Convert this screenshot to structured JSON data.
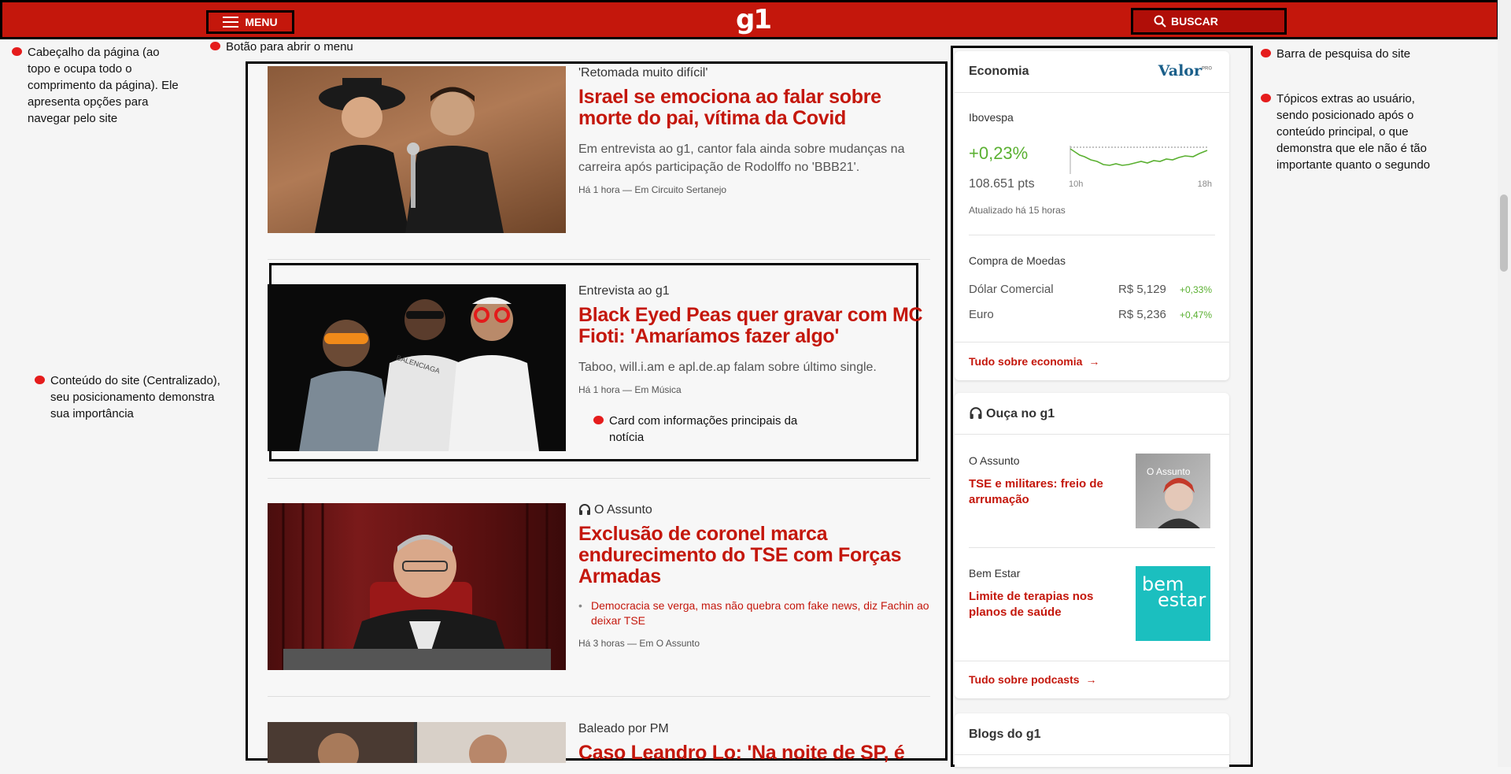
{
  "header": {
    "menu_label": "MENU",
    "logo": "g1",
    "search_label": "BUSCAR"
  },
  "annotations": {
    "header": "Cabeçalho da página (ao topo e ocupa todo o comprimento da página). Ele apresenta opções para navegar pelo site",
    "menu": "Botão para abrir o menu",
    "search": "Barra de pesquisa do site",
    "sidebar": "Tópicos extras ao usuário, sendo posicionado após o conteúdo principal, o que demonstra que ele não é tão importante quanto o segundo",
    "content": "Conteúdo do site (Centralizado), seu posicionamento demonstra sua importância",
    "card": "Card com informações principais da notícia"
  },
  "feed": [
    {
      "chapeu": "'Retomada muito difícil'",
      "headline": "Israel se emociona ao falar sobre morte do pai, vítima da Covid",
      "summary": "Em entrevista ao g1, cantor fala ainda sobre mudanças na carreira após participação de Rodolffo no 'BBB21'.",
      "meta": "Há 1 hora — Em Circuito Sertanejo"
    },
    {
      "chapeu": "Entrevista ao g1",
      "headline": "Black Eyed Peas quer gravar com MC Fioti: 'Amaríamos fazer algo'",
      "summary": "Taboo, will.i.am e apl.de.ap falam sobre último single.",
      "meta": "Há 1 hora — Em Música",
      "image_text": "BALENCIAGA"
    },
    {
      "chapeu": "O Assunto",
      "headline": "Exclusão de coronel marca endurecimento do TSE com Forças Armadas",
      "related": "Democracia se verga, mas não quebra com fake news, diz Fachin ao deixar TSE",
      "meta": "Há 3 horas — Em O Assunto"
    },
    {
      "chapeu": "Baleado por PM",
      "headline": "Caso Leandro Lo: 'Na noite de SP, é"
    }
  ],
  "sidebar": {
    "economia": {
      "title": "Economia",
      "brand": "Valor",
      "brand_sup": "PRO",
      "ibovespa_label": "Ibovespa",
      "ibovespa_change": "+0,23%",
      "ibovespa_points": "108.651 pts",
      "chart_start": "10h",
      "chart_end": "18h",
      "updated": "Atualizado há 15 horas",
      "moedas_label": "Compra de Moedas",
      "moedas": [
        {
          "name": "Dólar Comercial",
          "value": "R$ 5,129",
          "change": "+0,33%"
        },
        {
          "name": "Euro",
          "value": "R$ 5,236",
          "change": "+0,47%"
        }
      ],
      "link": "Tudo sobre economia"
    },
    "ouca": {
      "title": "Ouça no g1",
      "items": [
        {
          "program": "O Assunto",
          "title": "TSE e militares: freio de arrumação",
          "thumb_text": "O Assunto"
        },
        {
          "program": "Bem Estar",
          "title": "Limite de terapias nos planos de saúde",
          "thumb_text_1": "bem",
          "thumb_text_2": "estar"
        }
      ],
      "link": "Tudo sobre podcasts"
    },
    "blogs": {
      "title": "Blogs do g1"
    }
  },
  "colors": {
    "brand_red": "#c4170c",
    "positive_green": "#5ab031",
    "bemestar_teal": "#1bbfbf"
  }
}
